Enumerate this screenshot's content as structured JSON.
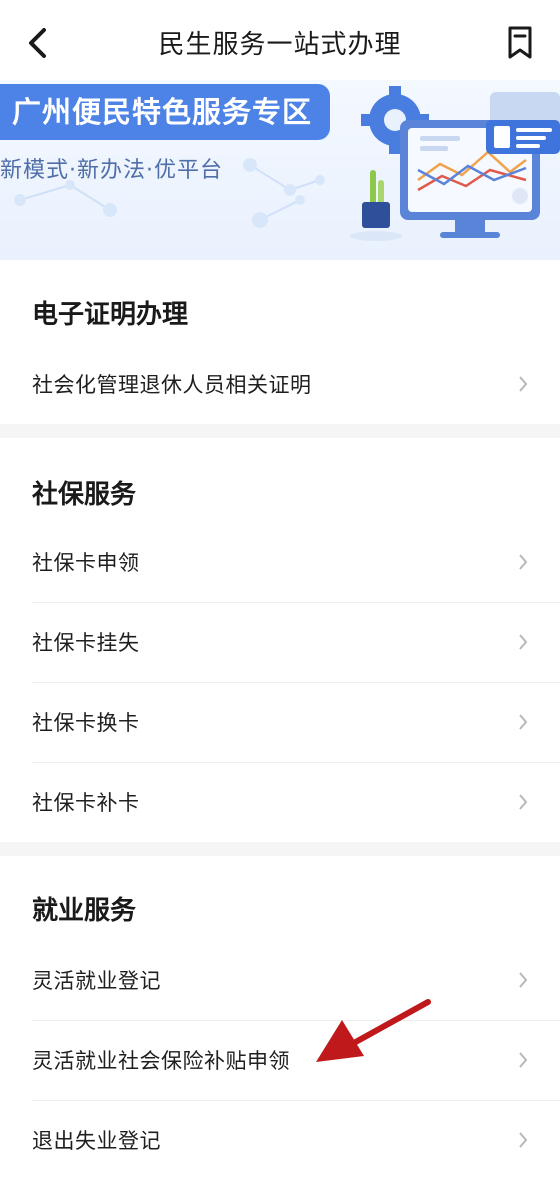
{
  "header": {
    "title": "民生服务一站式办理",
    "back_icon": "chevron-left-icon",
    "bookmark_icon": "bookmark-icon"
  },
  "banner": {
    "title": "广州便民特色服务专区",
    "subtitle": "新模式·新办法·优平台"
  },
  "sections": [
    {
      "title": "电子证明办理",
      "items": [
        "社会化管理退休人员相关证明"
      ]
    },
    {
      "title": "社保服务",
      "items": [
        "社保卡申领",
        "社保卡挂失",
        "社保卡换卡",
        "社保卡补卡"
      ]
    },
    {
      "title": "就业服务",
      "items": [
        "灵活就业登记",
        "灵活就业社会保险补贴申领",
        "退出失业登记"
      ]
    }
  ],
  "colors": {
    "banner_blue": "#4d82e6",
    "annotation_arrow": "#c0191b"
  }
}
